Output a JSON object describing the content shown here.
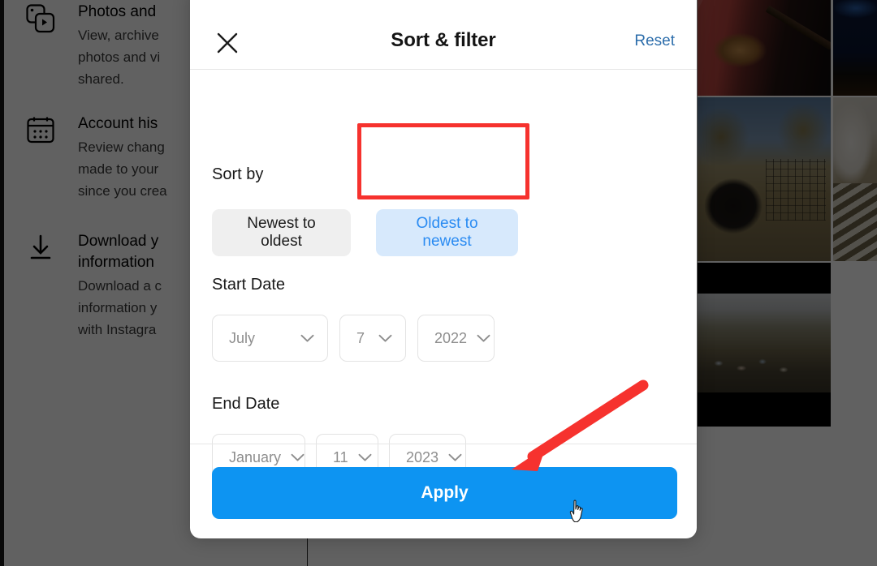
{
  "background": {
    "settings_items": [
      {
        "icon": "photos-and-videos-icon",
        "title": "Photos and",
        "description": "View, archive\nphotos and vi\nshared."
      },
      {
        "icon": "calendar-icon",
        "title": "Account his",
        "description": "Review chang\nmade to your\nsince you crea"
      },
      {
        "icon": "download-icon",
        "title": "Download y\ninformation",
        "description": "Download a c\ninformation y\nwith Instagra"
      }
    ],
    "photo_tiles": [
      {
        "name": "guitarist-photo"
      },
      {
        "name": "night-sky-photo"
      },
      {
        "name": "goat-in-pen-photo"
      },
      {
        "name": "white-alpaca-photo"
      },
      {
        "name": "aerial-landscape-photo"
      }
    ]
  },
  "modal": {
    "title": "Sort & filter",
    "close_icon": "close-icon",
    "reset_label": "Reset",
    "sort": {
      "label": "Sort by",
      "options": [
        {
          "label": "Newest to oldest",
          "selected": false
        },
        {
          "label": "Oldest to newest",
          "selected": true
        }
      ]
    },
    "start_date": {
      "label": "Start Date",
      "month": "July",
      "day": "7",
      "year": "2022"
    },
    "end_date": {
      "label": "End Date",
      "month": "January",
      "day": "11",
      "year": "2023"
    },
    "apply_label": "Apply"
  },
  "annotations": {
    "highlight_rect_target": "Oldest to newest",
    "arrow_target": "Apply",
    "color": "#f6322e"
  },
  "colors": {
    "accent_blue": "#0d94f2",
    "selected_pill_bg": "#d7e9fc",
    "selected_pill_text": "#2a8bf2",
    "unselected_pill_bg": "#efefef",
    "reset_link": "#2c6dab",
    "annotation_red": "#f6322e"
  }
}
